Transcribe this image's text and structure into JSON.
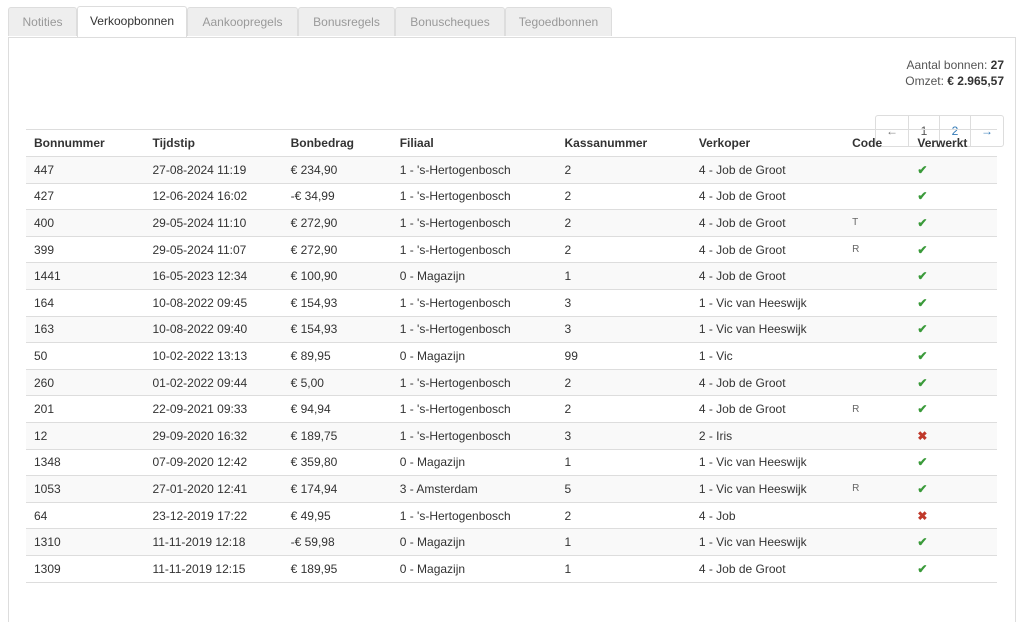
{
  "tabs": [
    {
      "label": "Notities",
      "active": false
    },
    {
      "label": "Verkoopbonnen",
      "active": true
    },
    {
      "label": "Aankoopregels",
      "active": false
    },
    {
      "label": "Bonusregels",
      "active": false
    },
    {
      "label": "Bonuscheques",
      "active": false
    },
    {
      "label": "Tegoedbonnen",
      "active": false
    }
  ],
  "summary": {
    "count_label": "Aantal bonnen:",
    "count_value": "27",
    "revenue_label": "Omzet:",
    "revenue_value": "€ 2.965,57"
  },
  "pager": {
    "prev": "←",
    "pages": [
      "1",
      "2"
    ],
    "current": "1",
    "next": "→"
  },
  "table": {
    "columns": [
      "Bonnummer",
      "Tijdstip",
      "Bonbedrag",
      "Filiaal",
      "Kassanummer",
      "Verkoper",
      "Code",
      "Verwerkt"
    ],
    "rows": [
      [
        "447",
        "27-08-2024 11:19",
        "€ 234,90",
        "1 - 's-Hertogenbosch",
        "2",
        "4 - Job de Groot",
        "",
        "yes"
      ],
      [
        "427",
        "12-06-2024 16:02",
        "-€ 34,99",
        "1 - 's-Hertogenbosch",
        "2",
        "4 - Job de Groot",
        "",
        "yes"
      ],
      [
        "400",
        "29-05-2024 11:10",
        "€ 272,90",
        "1 - 's-Hertogenbosch",
        "2",
        "4 - Job de Groot",
        "T",
        "yes"
      ],
      [
        "399",
        "29-05-2024 11:07",
        "€ 272,90",
        "1 - 's-Hertogenbosch",
        "2",
        "4 - Job de Groot",
        "R",
        "yes"
      ],
      [
        "1441",
        "16-05-2023 12:34",
        "€ 100,90",
        "0 - Magazijn",
        "1",
        "4 - Job de Groot",
        "",
        "yes"
      ],
      [
        "164",
        "10-08-2022 09:45",
        "€ 154,93",
        "1 - 's-Hertogenbosch",
        "3",
        "1 - Vic van Heeswijk",
        "",
        "yes"
      ],
      [
        "163",
        "10-08-2022 09:40",
        "€ 154,93",
        "1 - 's-Hertogenbosch",
        "3",
        "1 - Vic van Heeswijk",
        "",
        "yes"
      ],
      [
        "50",
        "10-02-2022 13:13",
        "€ 89,95",
        "0 - Magazijn",
        "99",
        "1 - Vic",
        "",
        "yes"
      ],
      [
        "260",
        "01-02-2022 09:44",
        "€ 5,00",
        "1 - 's-Hertogenbosch",
        "2",
        "4 - Job de Groot",
        "",
        "yes"
      ],
      [
        "201",
        "22-09-2021 09:33",
        "€ 94,94",
        "1 - 's-Hertogenbosch",
        "2",
        "4 - Job de Groot",
        "R",
        "yes"
      ],
      [
        "12",
        "29-09-2020 16:32",
        "€ 189,75",
        "1 - 's-Hertogenbosch",
        "3",
        "2 - Iris",
        "",
        "no"
      ],
      [
        "1348",
        "07-09-2020 12:42",
        "€ 359,80",
        "0 - Magazijn",
        "1",
        "1 - Vic van Heeswijk",
        "",
        "yes"
      ],
      [
        "1053",
        "27-01-2020 12:41",
        "€ 174,94",
        "3 - Amsterdam",
        "5",
        "1 - Vic van Heeswijk",
        "R",
        "yes"
      ],
      [
        "64",
        "23-12-2019 17:22",
        "€ 49,95",
        "1 - 's-Hertogenbosch",
        "2",
        "4 - Job",
        "",
        "no"
      ],
      [
        "1310",
        "11-11-2019 12:18",
        "-€ 59,98",
        "0 - Magazijn",
        "1",
        "1 - Vic van Heeswijk",
        "",
        "yes"
      ],
      [
        "1309",
        "11-11-2019 12:15",
        "€ 189,95",
        "0 - Magazijn",
        "1",
        "4 - Job de Groot",
        "",
        "yes"
      ]
    ]
  },
  "icons": {
    "yes": "check-icon",
    "no": "cross-icon"
  },
  "colors": {
    "check": "#3a9a3a",
    "cross": "#c0392b",
    "link": "#337ab7"
  }
}
